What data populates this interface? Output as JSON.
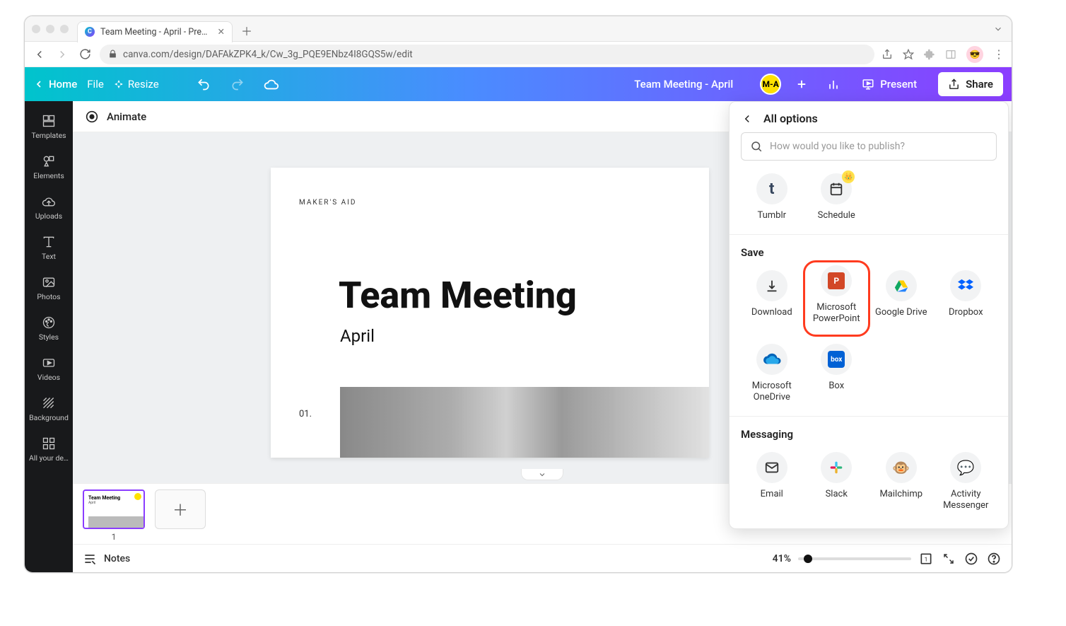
{
  "browser": {
    "tab_title": "Team Meeting - April - Present",
    "url": "canva.com/design/DAFAkZPK4_k/Cw_3g_PQE9ENbz4I8GQS5w/edit"
  },
  "appbar": {
    "home": "Home",
    "file": "File",
    "resize": "Resize",
    "doc_title": "Team Meeting - April",
    "user_initials": "M-A",
    "present": "Present",
    "share": "Share"
  },
  "toolbar": {
    "animate": "Animate"
  },
  "sidepanel": {
    "items": [
      {
        "label": "Templates",
        "icon": "templates"
      },
      {
        "label": "Elements",
        "icon": "elements"
      },
      {
        "label": "Uploads",
        "icon": "uploads"
      },
      {
        "label": "Text",
        "icon": "text"
      },
      {
        "label": "Photos",
        "icon": "photos"
      },
      {
        "label": "Styles",
        "icon": "styles"
      },
      {
        "label": "Videos",
        "icon": "videos"
      },
      {
        "label": "Background",
        "icon": "background"
      },
      {
        "label": "All your de…",
        "icon": "more"
      }
    ]
  },
  "slide": {
    "brand": "MAKER'S AID",
    "title": "Team Meeting",
    "subtitle": "April",
    "number": "01."
  },
  "thumbs": {
    "page_number": "1"
  },
  "footer": {
    "notes": "Notes",
    "zoom": "41%"
  },
  "popover": {
    "heading": "All options",
    "search_placeholder": "How would you like to publish?",
    "sections": {
      "top_row": [
        {
          "label": "Tumblr",
          "icon": "tumblr"
        },
        {
          "label": "Schedule",
          "icon": "schedule",
          "crown": true
        }
      ],
      "save_title": "Save",
      "save": [
        {
          "label": "Download",
          "icon": "download"
        },
        {
          "label": "Microsoft PowerPoint",
          "icon": "ppt",
          "highlight": true
        },
        {
          "label": "Google Drive",
          "icon": "gdrive"
        },
        {
          "label": "Dropbox",
          "icon": "dropbox"
        },
        {
          "label": "Microsoft OneDrive",
          "icon": "onedrive"
        },
        {
          "label": "Box",
          "icon": "box"
        }
      ],
      "messaging_title": "Messaging",
      "messaging": [
        {
          "label": "Email",
          "icon": "email"
        },
        {
          "label": "Slack",
          "icon": "slack"
        },
        {
          "label": "Mailchimp",
          "icon": "mailchimp"
        },
        {
          "label": "Activity Messenger",
          "icon": "activity"
        }
      ]
    }
  }
}
